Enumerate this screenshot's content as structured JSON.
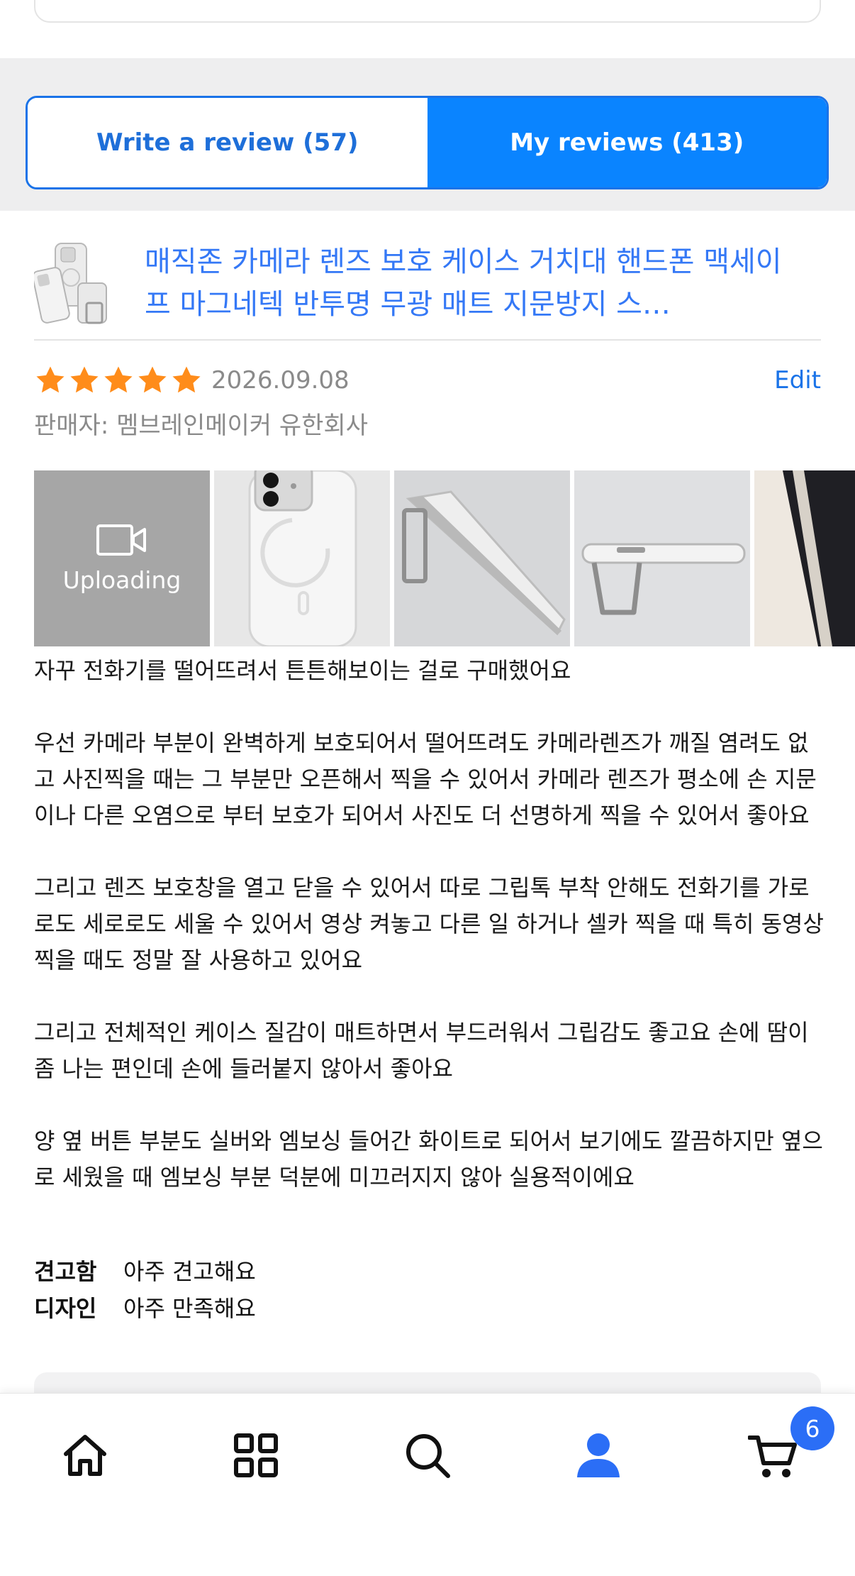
{
  "tabs": {
    "write": "Write a review (57)",
    "mine": "My reviews (413)"
  },
  "product": {
    "title": "매직존 카메라 렌즈 보호 케이스 거치대 핸드폰 맥세이프 마그네텍 반투명 무광 매트 지문방지 스…",
    "thumb_icon": "phone-case-thumbnail"
  },
  "review": {
    "rating": 5,
    "rating_max": 5,
    "date": "2026.09.08",
    "edit_label": "Edit",
    "seller": "판매자: 멤브레인메이커 유한회사",
    "upload_label": "Uploading",
    "paragraphs": [
      "자꾸 전화기를 떨어뜨려서 튼튼해보이는 걸로 구매했어요",
      "우선 카메라 부분이 완벽하게 보호되어서 떨어뜨려도 카메라렌즈가 깨질 염려도 없고 사진찍을 때는 그 부분만 오픈해서 찍을 수 있어서 카메라 렌즈가 평소에 손 지문이나 다른 오염으로 부터 보호가 되어서 사진도 더 선명하게 찍을 수 있어서 좋아요",
      "그리고 렌즈 보호창을 열고 닫을 수 있어서 따로 그립톡 부착 안해도 전화기를 가로로도 세로로도 세울 수 있어서 영상 켜놓고 다른 일 하거나 셀카 찍을 때 특히 동영상 찍을 때도 정말 잘 사용하고 있어요",
      "그리고 전체적인 케이스 질감이 매트하면서 부드러워서 그립감도 좋고요 손에 땀이 좀 나는 편인데 손에 들러붙지 않아서 좋아요",
      "양 옆 버튼 부분도 실버와 엠보싱 들어간 화이트로 되어서 보기에도 깔끔하지만 옆으로 세웠을 때 엠보싱 부분 덕분에 미끄러지지 않아 실용적이에요"
    ],
    "attributes": [
      {
        "key": "견고함",
        "value": "아주 견고해요"
      },
      {
        "key": "디자인",
        "value": "아주 만족해요"
      }
    ]
  },
  "nav": {
    "items": [
      "home-icon",
      "categories-icon",
      "search-icon",
      "profile-icon",
      "cart-icon"
    ],
    "cart_badge": "6"
  },
  "colors": {
    "accent": "#0a84ff",
    "link": "#3478f6",
    "star": "#ff8c1a",
    "upload_tile": "#a6a6a6",
    "badge": "#2b6ef6"
  }
}
